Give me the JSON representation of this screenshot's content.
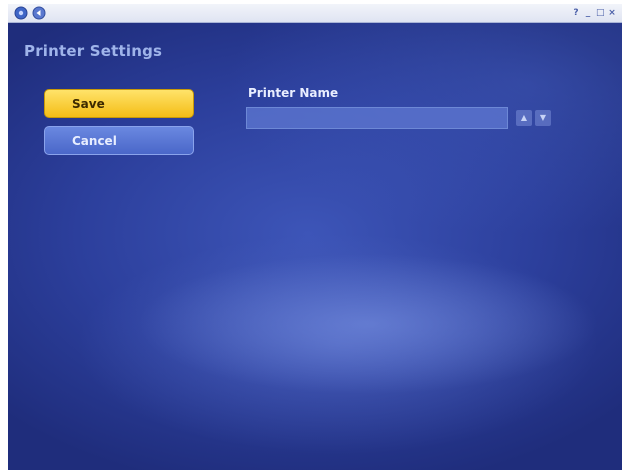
{
  "titlebar": {
    "icons": {
      "media_center": "windows-media-center-icon",
      "back": "back-arrow-icon"
    },
    "controls": [
      "?",
      "_",
      "□",
      "×"
    ]
  },
  "page": {
    "title": "Printer Settings"
  },
  "actions": {
    "save_label": "Save",
    "cancel_label": "Cancel"
  },
  "printer_name": {
    "label": "Printer Name",
    "value": "",
    "up_symbol": "▲",
    "down_symbol": "▼"
  },
  "colors": {
    "background": "#2c3f9c",
    "accent": "#f4bd16",
    "button": "#4a67c9"
  }
}
